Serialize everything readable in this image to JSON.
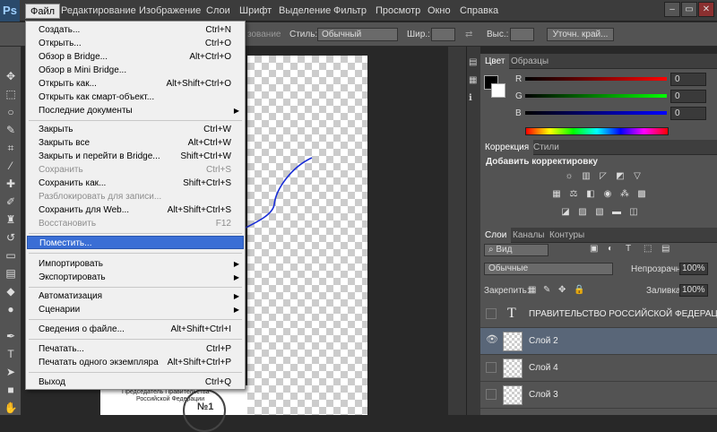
{
  "app": {
    "logo": "Ps"
  },
  "menubar": {
    "items": [
      "Файл",
      "Редактирование",
      "Изображение",
      "Слои",
      "Шрифт",
      "Выделение",
      "Фильтр",
      "Просмотр",
      "Окно",
      "Справка"
    ]
  },
  "window_buttons": {
    "min": "–",
    "restore": "▭",
    "close": "✕"
  },
  "options_bar": {
    "style_label": "Стиль:",
    "style_value": "Обычный",
    "width_label": "Шир.:",
    "height_label": "Выс.:",
    "refine_button": "Уточн. край...",
    "faded_text": "зование"
  },
  "file_menu": {
    "items": [
      {
        "label": "Создать...",
        "shortcut": "Ctrl+N"
      },
      {
        "label": "Открыть...",
        "shortcut": "Ctrl+O"
      },
      {
        "label": "Обзор в Bridge...",
        "shortcut": "Alt+Ctrl+O"
      },
      {
        "label": "Обзор в Mini Bridge...",
        "shortcut": ""
      },
      {
        "label": "Открыть как...",
        "shortcut": "Alt+Shift+Ctrl+O"
      },
      {
        "label": "Открыть как смарт-объект...",
        "shortcut": ""
      },
      {
        "label": "Последние документы",
        "shortcut": ""
      },
      {
        "label": "Закрыть",
        "shortcut": "Ctrl+W"
      },
      {
        "label": "Закрыть все",
        "shortcut": "Alt+Ctrl+W"
      },
      {
        "label": "Закрыть и перейти в Bridge...",
        "shortcut": "Shift+Ctrl+W"
      },
      {
        "label": "Сохранить",
        "shortcut": "Ctrl+S"
      },
      {
        "label": "Сохранить как...",
        "shortcut": "Shift+Ctrl+S"
      },
      {
        "label": "Разблокировать для записи...",
        "shortcut": ""
      },
      {
        "label": "Сохранить для Web...",
        "shortcut": "Alt+Shift+Ctrl+S"
      },
      {
        "label": "Восстановить",
        "shortcut": "F12"
      },
      {
        "label": "Поместить...",
        "shortcut": ""
      },
      {
        "label": "Импортировать",
        "shortcut": ""
      },
      {
        "label": "Экспортировать",
        "shortcut": ""
      },
      {
        "label": "Автоматизация",
        "shortcut": ""
      },
      {
        "label": "Сценарии",
        "shortcut": ""
      },
      {
        "label": "Сведения о файле...",
        "shortcut": "Alt+Shift+Ctrl+I"
      },
      {
        "label": "Печатать...",
        "shortcut": "Ctrl+P"
      },
      {
        "label": "Печатать одного экземпляра",
        "shortcut": "Alt+Shift+Ctrl+P"
      },
      {
        "label": "Выход",
        "shortcut": "Ctrl+Q"
      }
    ]
  },
  "color_panel": {
    "tabs": [
      "Цвет",
      "Образцы"
    ],
    "r_label": "R",
    "g_label": "G",
    "b_label": "B",
    "r_value": "0",
    "g_value": "0",
    "b_value": "0"
  },
  "adjustments_panel": {
    "tabs": [
      "Коррекция",
      "Стили"
    ],
    "title": "Добавить корректировку"
  },
  "layers_panel": {
    "tabs": [
      "Слои",
      "Каналы",
      "Контуры"
    ],
    "filter": "Вид",
    "blend_mode": "Обычные",
    "opacity_label": "Непрозрачность:",
    "opacity_value": "100%",
    "lock_label": "Закрепить:",
    "fill_label": "Заливка:",
    "fill_value": "100%",
    "layers": [
      {
        "name": "ПРАВИТЕЛЬСТВО РОССИЙСКОЙ ФЕДЕРАЦИИ  Р..."
      },
      {
        "name": "Слой 2"
      },
      {
        "name": "Слой 4"
      },
      {
        "name": "Слой 3"
      }
    ]
  },
  "document": {
    "footer_line1": "Председатель Правительства",
    "footer_line2": "Российской Федерации",
    "stamp_text": "№1"
  },
  "colors": {
    "accent": "#3a6ed5",
    "selected_layer": "#596678",
    "annotation": "#1a2fd6"
  }
}
